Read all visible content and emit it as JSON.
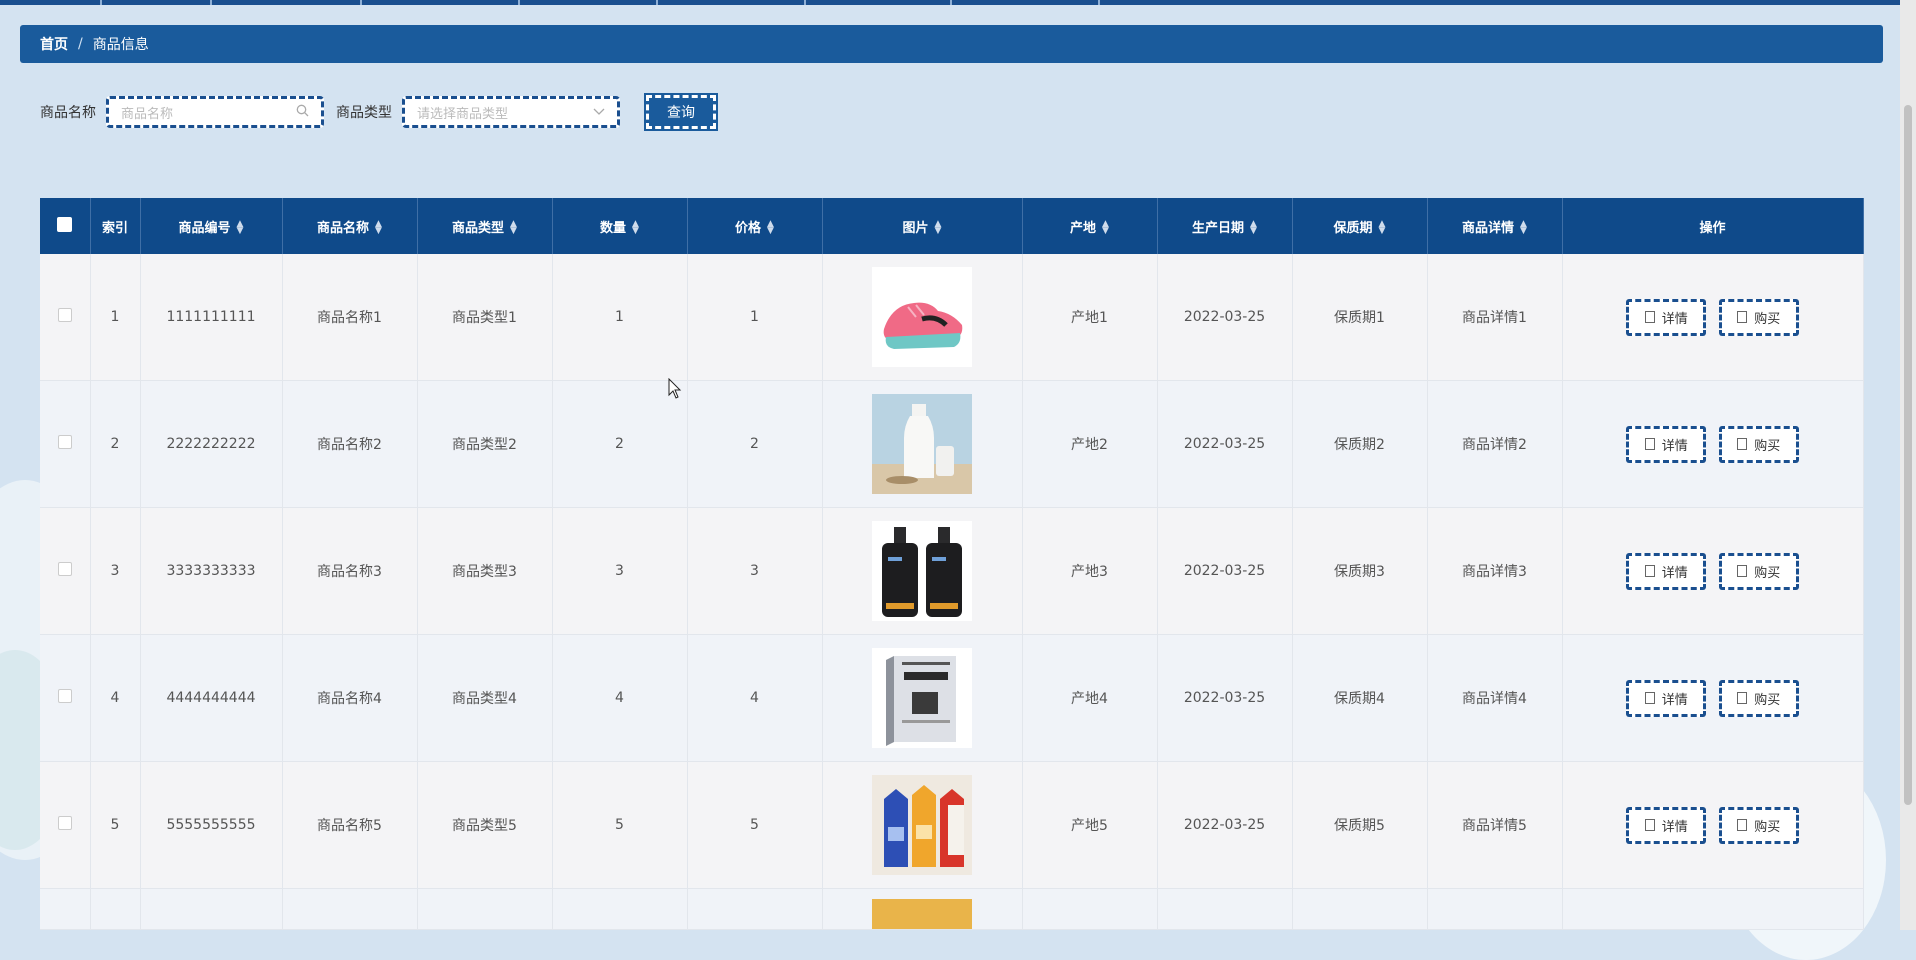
{
  "breadcrumb": {
    "home": "首页",
    "separator": "/",
    "current": "商品信息"
  },
  "search": {
    "name_label": "商品名称",
    "name_placeholder": "商品名称",
    "type_label": "商品类型",
    "type_placeholder": "请选择商品类型",
    "query_button": "查询"
  },
  "table": {
    "headers": {
      "index": "索引",
      "code": "商品编号",
      "name": "商品名称",
      "type": "商品类型",
      "qty": "数量",
      "price": "价格",
      "image": "图片",
      "origin": "产地",
      "date": "生产日期",
      "shelf": "保质期",
      "detail": "商品详情",
      "ops": "操作"
    },
    "rows": [
      {
        "index": "1",
        "code": "1111111111",
        "name": "商品名称1",
        "type": "商品类型1",
        "qty": "1",
        "price": "1",
        "image": "pink-sneaker-image",
        "origin": "产地1",
        "date": "2022-03-25",
        "shelf": "保质期1",
        "detail": "商品详情1"
      },
      {
        "index": "2",
        "code": "2222222222",
        "name": "商品名称2",
        "type": "商品类型2",
        "qty": "2",
        "price": "2",
        "image": "milk-bottles-image",
        "origin": "产地2",
        "date": "2022-03-25",
        "shelf": "保质期2",
        "detail": "商品详情2"
      },
      {
        "index": "3",
        "code": "3333333333",
        "name": "商品名称3",
        "type": "商品类型3",
        "qty": "3",
        "price": "3",
        "image": "cleanser-bottles-image",
        "origin": "产地3",
        "date": "2022-03-25",
        "shelf": "保质期3",
        "detail": "商品详情3"
      },
      {
        "index": "4",
        "code": "4444444444",
        "name": "商品名称4",
        "type": "商品类型4",
        "qty": "4",
        "price": "4",
        "image": "book-image",
        "origin": "产地4",
        "date": "2022-03-25",
        "shelf": "保质期4",
        "detail": "商品详情4"
      },
      {
        "index": "5",
        "code": "5555555555",
        "name": "商品名称5",
        "type": "商品类型5",
        "qty": "5",
        "price": "5",
        "image": "milk-cartons-image",
        "origin": "产地5",
        "date": "2022-03-25",
        "shelf": "保质期5",
        "detail": "商品详情5"
      }
    ],
    "detail_button": "详情",
    "buy_button": "购买"
  },
  "colors": {
    "primary": "#1a5b9c",
    "header": "#0f4a8a",
    "background": "#d4e3f1"
  }
}
